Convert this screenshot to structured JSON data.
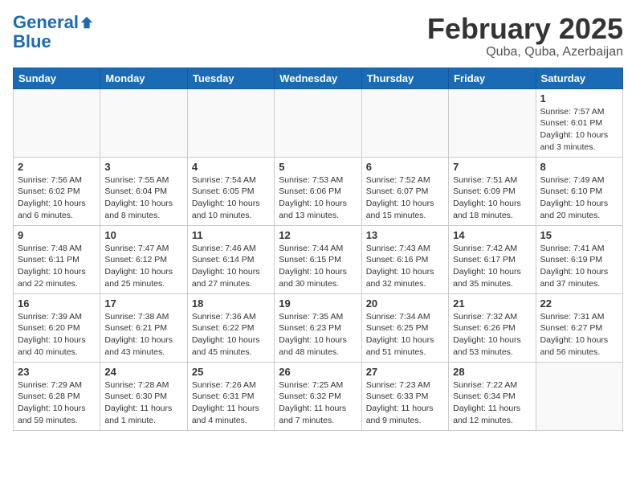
{
  "logo": {
    "line1": "General",
    "line2": "Blue"
  },
  "title": "February 2025",
  "location": "Quba, Quba, Azerbaijan",
  "weekdays": [
    "Sunday",
    "Monday",
    "Tuesday",
    "Wednesday",
    "Thursday",
    "Friday",
    "Saturday"
  ],
  "weeks": [
    [
      {
        "day": "",
        "info": ""
      },
      {
        "day": "",
        "info": ""
      },
      {
        "day": "",
        "info": ""
      },
      {
        "day": "",
        "info": ""
      },
      {
        "day": "",
        "info": ""
      },
      {
        "day": "",
        "info": ""
      },
      {
        "day": "1",
        "info": "Sunrise: 7:57 AM\nSunset: 6:01 PM\nDaylight: 10 hours\nand 3 minutes."
      }
    ],
    [
      {
        "day": "2",
        "info": "Sunrise: 7:56 AM\nSunset: 6:02 PM\nDaylight: 10 hours\nand 6 minutes."
      },
      {
        "day": "3",
        "info": "Sunrise: 7:55 AM\nSunset: 6:04 PM\nDaylight: 10 hours\nand 8 minutes."
      },
      {
        "day": "4",
        "info": "Sunrise: 7:54 AM\nSunset: 6:05 PM\nDaylight: 10 hours\nand 10 minutes."
      },
      {
        "day": "5",
        "info": "Sunrise: 7:53 AM\nSunset: 6:06 PM\nDaylight: 10 hours\nand 13 minutes."
      },
      {
        "day": "6",
        "info": "Sunrise: 7:52 AM\nSunset: 6:07 PM\nDaylight: 10 hours\nand 15 minutes."
      },
      {
        "day": "7",
        "info": "Sunrise: 7:51 AM\nSunset: 6:09 PM\nDaylight: 10 hours\nand 18 minutes."
      },
      {
        "day": "8",
        "info": "Sunrise: 7:49 AM\nSunset: 6:10 PM\nDaylight: 10 hours\nand 20 minutes."
      }
    ],
    [
      {
        "day": "9",
        "info": "Sunrise: 7:48 AM\nSunset: 6:11 PM\nDaylight: 10 hours\nand 22 minutes."
      },
      {
        "day": "10",
        "info": "Sunrise: 7:47 AM\nSunset: 6:12 PM\nDaylight: 10 hours\nand 25 minutes."
      },
      {
        "day": "11",
        "info": "Sunrise: 7:46 AM\nSunset: 6:14 PM\nDaylight: 10 hours\nand 27 minutes."
      },
      {
        "day": "12",
        "info": "Sunrise: 7:44 AM\nSunset: 6:15 PM\nDaylight: 10 hours\nand 30 minutes."
      },
      {
        "day": "13",
        "info": "Sunrise: 7:43 AM\nSunset: 6:16 PM\nDaylight: 10 hours\nand 32 minutes."
      },
      {
        "day": "14",
        "info": "Sunrise: 7:42 AM\nSunset: 6:17 PM\nDaylight: 10 hours\nand 35 minutes."
      },
      {
        "day": "15",
        "info": "Sunrise: 7:41 AM\nSunset: 6:19 PM\nDaylight: 10 hours\nand 37 minutes."
      }
    ],
    [
      {
        "day": "16",
        "info": "Sunrise: 7:39 AM\nSunset: 6:20 PM\nDaylight: 10 hours\nand 40 minutes."
      },
      {
        "day": "17",
        "info": "Sunrise: 7:38 AM\nSunset: 6:21 PM\nDaylight: 10 hours\nand 43 minutes."
      },
      {
        "day": "18",
        "info": "Sunrise: 7:36 AM\nSunset: 6:22 PM\nDaylight: 10 hours\nand 45 minutes."
      },
      {
        "day": "19",
        "info": "Sunrise: 7:35 AM\nSunset: 6:23 PM\nDaylight: 10 hours\nand 48 minutes."
      },
      {
        "day": "20",
        "info": "Sunrise: 7:34 AM\nSunset: 6:25 PM\nDaylight: 10 hours\nand 51 minutes."
      },
      {
        "day": "21",
        "info": "Sunrise: 7:32 AM\nSunset: 6:26 PM\nDaylight: 10 hours\nand 53 minutes."
      },
      {
        "day": "22",
        "info": "Sunrise: 7:31 AM\nSunset: 6:27 PM\nDaylight: 10 hours\nand 56 minutes."
      }
    ],
    [
      {
        "day": "23",
        "info": "Sunrise: 7:29 AM\nSunset: 6:28 PM\nDaylight: 10 hours\nand 59 minutes."
      },
      {
        "day": "24",
        "info": "Sunrise: 7:28 AM\nSunset: 6:30 PM\nDaylight: 11 hours\nand 1 minute."
      },
      {
        "day": "25",
        "info": "Sunrise: 7:26 AM\nSunset: 6:31 PM\nDaylight: 11 hours\nand 4 minutes."
      },
      {
        "day": "26",
        "info": "Sunrise: 7:25 AM\nSunset: 6:32 PM\nDaylight: 11 hours\nand 7 minutes."
      },
      {
        "day": "27",
        "info": "Sunrise: 7:23 AM\nSunset: 6:33 PM\nDaylight: 11 hours\nand 9 minutes."
      },
      {
        "day": "28",
        "info": "Sunrise: 7:22 AM\nSunset: 6:34 PM\nDaylight: 11 hours\nand 12 minutes."
      },
      {
        "day": "",
        "info": ""
      }
    ]
  ]
}
